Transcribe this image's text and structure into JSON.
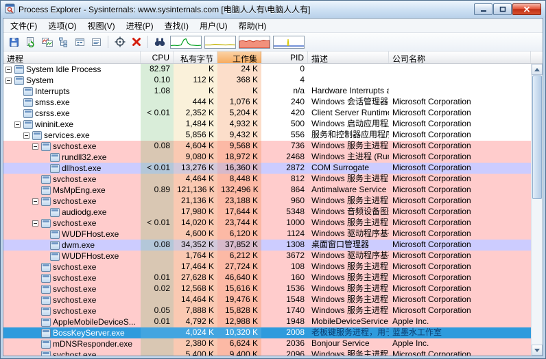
{
  "window": {
    "title": "Process Explorer - Sysinternals: www.sysinternals.com [电脑人人有\\电脑人人有]",
    "controls": [
      "minimize",
      "maximize",
      "close"
    ]
  },
  "menu": {
    "items": [
      "文件(F)",
      "选项(O)",
      "视图(V)",
      "进程(P)",
      "查找(I)",
      "用户(U)",
      "帮助(H)"
    ]
  },
  "toolbar": {
    "icons": [
      "save-icon",
      "refresh-icon",
      "system-information-icon",
      "process-tree-icon",
      "dll-view-icon",
      "handle-view-icon",
      "find-window-icon",
      "kill-process-icon",
      "find-icon"
    ],
    "graphs": [
      "cpu-graph",
      "commit-graph",
      "physical-memory-graph",
      "io-graph"
    ]
  },
  "header": {
    "columns": [
      "进程",
      "CPU",
      "私有字节",
      "工作集",
      "PID",
      "描述",
      "公司名称"
    ],
    "sorted_column": "工作集"
  },
  "colors": {
    "service_row": "#FFCCCC",
    "own_process_row": "#CCCCFF",
    "selected_row": "#2E9BDD",
    "sorted_column_header": "#F6AB60",
    "cpu_column_tint": "#E7F3E7",
    "private_bytes_column_tint": "#FAF0DC",
    "working_set_column_tint": "#F9E2D0"
  },
  "processes": [
    {
      "name": "System Idle Process",
      "level": 0,
      "expand": true,
      "cpu": "82.97",
      "priv": "K",
      "ws": "24 K",
      "pid": "0",
      "desc": "",
      "company": "",
      "highlight": "none"
    },
    {
      "name": "System",
      "level": 0,
      "expand": true,
      "cpu": "0.10",
      "priv": "112 K",
      "ws": "368 K",
      "pid": "4",
      "desc": "",
      "company": "",
      "highlight": "none"
    },
    {
      "name": "Interrupts",
      "level": 1,
      "expand": false,
      "cpu": "1.08",
      "priv": "K",
      "ws": "K",
      "pid": "n/a",
      "desc": "Hardware Interrupts a...",
      "company": "",
      "highlight": "none"
    },
    {
      "name": "smss.exe",
      "level": 1,
      "expand": false,
      "cpu": "",
      "priv": "444 K",
      "ws": "1,076 K",
      "pid": "240",
      "desc": "Windows 会话管理器",
      "company": "Microsoft Corporation",
      "highlight": "none"
    },
    {
      "name": "csrss.exe",
      "level": 1,
      "expand": false,
      "cpu": "< 0.01",
      "priv": "2,352 K",
      "ws": "5,204 K",
      "pid": "420",
      "desc": "Client Server Runtime...",
      "company": "Microsoft Corporation",
      "highlight": "none"
    },
    {
      "name": "wininit.exe",
      "level": 1,
      "expand": true,
      "cpu": "",
      "priv": "1,484 K",
      "ws": "4,932 K",
      "pid": "500",
      "desc": "Windows 启动应用程序",
      "company": "Microsoft Corporation",
      "highlight": "none"
    },
    {
      "name": "services.exe",
      "level": 2,
      "expand": true,
      "cpu": "",
      "priv": "5,856 K",
      "ws": "9,432 K",
      "pid": "556",
      "desc": "服务和控制器应用程序",
      "company": "Microsoft Corporation",
      "highlight": "none"
    },
    {
      "name": "svchost.exe",
      "level": 3,
      "expand": true,
      "cpu": "0.08",
      "priv": "4,604 K",
      "ws": "9,568 K",
      "pid": "736",
      "desc": "Windows 服务主进程",
      "company": "Microsoft Corporation",
      "highlight": "service"
    },
    {
      "name": "rundll32.exe",
      "level": 4,
      "expand": false,
      "cpu": "",
      "priv": "9,080 K",
      "ws": "18,972 K",
      "pid": "2468",
      "desc": "Windows 主进程 (Rundl...",
      "company": "Microsoft Corporation",
      "highlight": "service"
    },
    {
      "name": "dllhost.exe",
      "level": 4,
      "expand": false,
      "cpu": "< 0.01",
      "priv": "13,276 K",
      "ws": "16,360 K",
      "pid": "2872",
      "desc": "COM Surrogate",
      "company": "Microsoft Corporation",
      "highlight": "own"
    },
    {
      "name": "svchost.exe",
      "level": 3,
      "expand": false,
      "cpu": "",
      "priv": "4,464 K",
      "ws": "8,448 K",
      "pid": "812",
      "desc": "Windows 服务主进程",
      "company": "Microsoft Corporation",
      "highlight": "service"
    },
    {
      "name": "MsMpEng.exe",
      "level": 3,
      "expand": false,
      "cpu": "0.89",
      "priv": "121,136 K",
      "ws": "132,496 K",
      "pid": "864",
      "desc": "Antimalware Service E...",
      "company": "Microsoft Corporation",
      "highlight": "service"
    },
    {
      "name": "svchost.exe",
      "level": 3,
      "expand": true,
      "cpu": "",
      "priv": "21,136 K",
      "ws": "23,188 K",
      "pid": "960",
      "desc": "Windows 服务主进程",
      "company": "Microsoft Corporation",
      "highlight": "service"
    },
    {
      "name": "audiodg.exe",
      "level": 4,
      "expand": false,
      "cpu": "",
      "priv": "17,980 K",
      "ws": "17,644 K",
      "pid": "5348",
      "desc": "Windows 音频设备图形隔离",
      "company": "Microsoft Corporation",
      "highlight": "service"
    },
    {
      "name": "svchost.exe",
      "level": 3,
      "expand": true,
      "cpu": "< 0.01",
      "priv": "14,020 K",
      "ws": "23,744 K",
      "pid": "1000",
      "desc": "Windows 服务主进程",
      "company": "Microsoft Corporation",
      "highlight": "service"
    },
    {
      "name": "WUDFHost.exe",
      "level": 4,
      "expand": false,
      "cpu": "",
      "priv": "4,600 K",
      "ws": "6,120 K",
      "pid": "1124",
      "desc": "Windows 驱动程序基础 -...",
      "company": "Microsoft Corporation",
      "highlight": "service"
    },
    {
      "name": "dwm.exe",
      "level": 4,
      "expand": false,
      "cpu": "0.08",
      "priv": "34,352 K",
      "ws": "37,852 K",
      "pid": "1308",
      "desc": "桌面窗口管理器",
      "company": "Microsoft Corporation",
      "highlight": "own"
    },
    {
      "name": "WUDFHost.exe",
      "level": 4,
      "expand": false,
      "cpu": "",
      "priv": "1,764 K",
      "ws": "6,212 K",
      "pid": "3672",
      "desc": "Windows 驱动程序基础 -...",
      "company": "Microsoft Corporation",
      "highlight": "service"
    },
    {
      "name": "svchost.exe",
      "level": 3,
      "expand": false,
      "cpu": "",
      "priv": "17,464 K",
      "ws": "27,724 K",
      "pid": "108",
      "desc": "Windows 服务主进程",
      "company": "Microsoft Corporation",
      "highlight": "service"
    },
    {
      "name": "svchost.exe",
      "level": 3,
      "expand": false,
      "cpu": "0.01",
      "priv": "27,628 K",
      "ws": "46,640 K",
      "pid": "160",
      "desc": "Windows 服务主进程",
      "company": "Microsoft Corporation",
      "highlight": "service"
    },
    {
      "name": "svchost.exe",
      "level": 3,
      "expand": false,
      "cpu": "0.02",
      "priv": "12,568 K",
      "ws": "15,616 K",
      "pid": "1536",
      "desc": "Windows 服务主进程",
      "company": "Microsoft Corporation",
      "highlight": "service"
    },
    {
      "name": "svchost.exe",
      "level": 3,
      "expand": false,
      "cpu": "",
      "priv": "14,464 K",
      "ws": "19,476 K",
      "pid": "1548",
      "desc": "Windows 服务主进程",
      "company": "Microsoft Corporation",
      "highlight": "service"
    },
    {
      "name": "svchost.exe",
      "level": 3,
      "expand": false,
      "cpu": "0.05",
      "priv": "7,888 K",
      "ws": "15,828 K",
      "pid": "1740",
      "desc": "Windows 服务主进程",
      "company": "Microsoft Corporation",
      "highlight": "service"
    },
    {
      "name": "AppleMobileDeviceS...",
      "level": 3,
      "expand": false,
      "cpu": "0.01",
      "priv": "4,792 K",
      "ws": "12,988 K",
      "pid": "1948",
      "desc": "MobileDeviceService",
      "company": "Apple Inc.",
      "highlight": "service"
    },
    {
      "name": "BossKeyServer.exe",
      "level": 3,
      "expand": false,
      "cpu": "",
      "priv": "4,024 K",
      "ws": "10,320 K",
      "pid": "2008",
      "desc": "老板键服务进程，用于开...",
      "company": "蓝墨水工作室",
      "highlight": "selected"
    },
    {
      "name": "mDNSResponder.exe",
      "level": 3,
      "expand": false,
      "cpu": "",
      "priv": "2,380 K",
      "ws": "6,624 K",
      "pid": "2036",
      "desc": "Bonjour Service",
      "company": "Apple Inc.",
      "highlight": "service"
    },
    {
      "name": "svchost.exe",
      "level": 3,
      "expand": false,
      "cpu": "",
      "priv": "5,400 K",
      "ws": "9,400 K",
      "pid": "2096",
      "desc": "Windows 服务主进程",
      "company": "Microsoft Corporation",
      "highlight": "service"
    }
  ]
}
